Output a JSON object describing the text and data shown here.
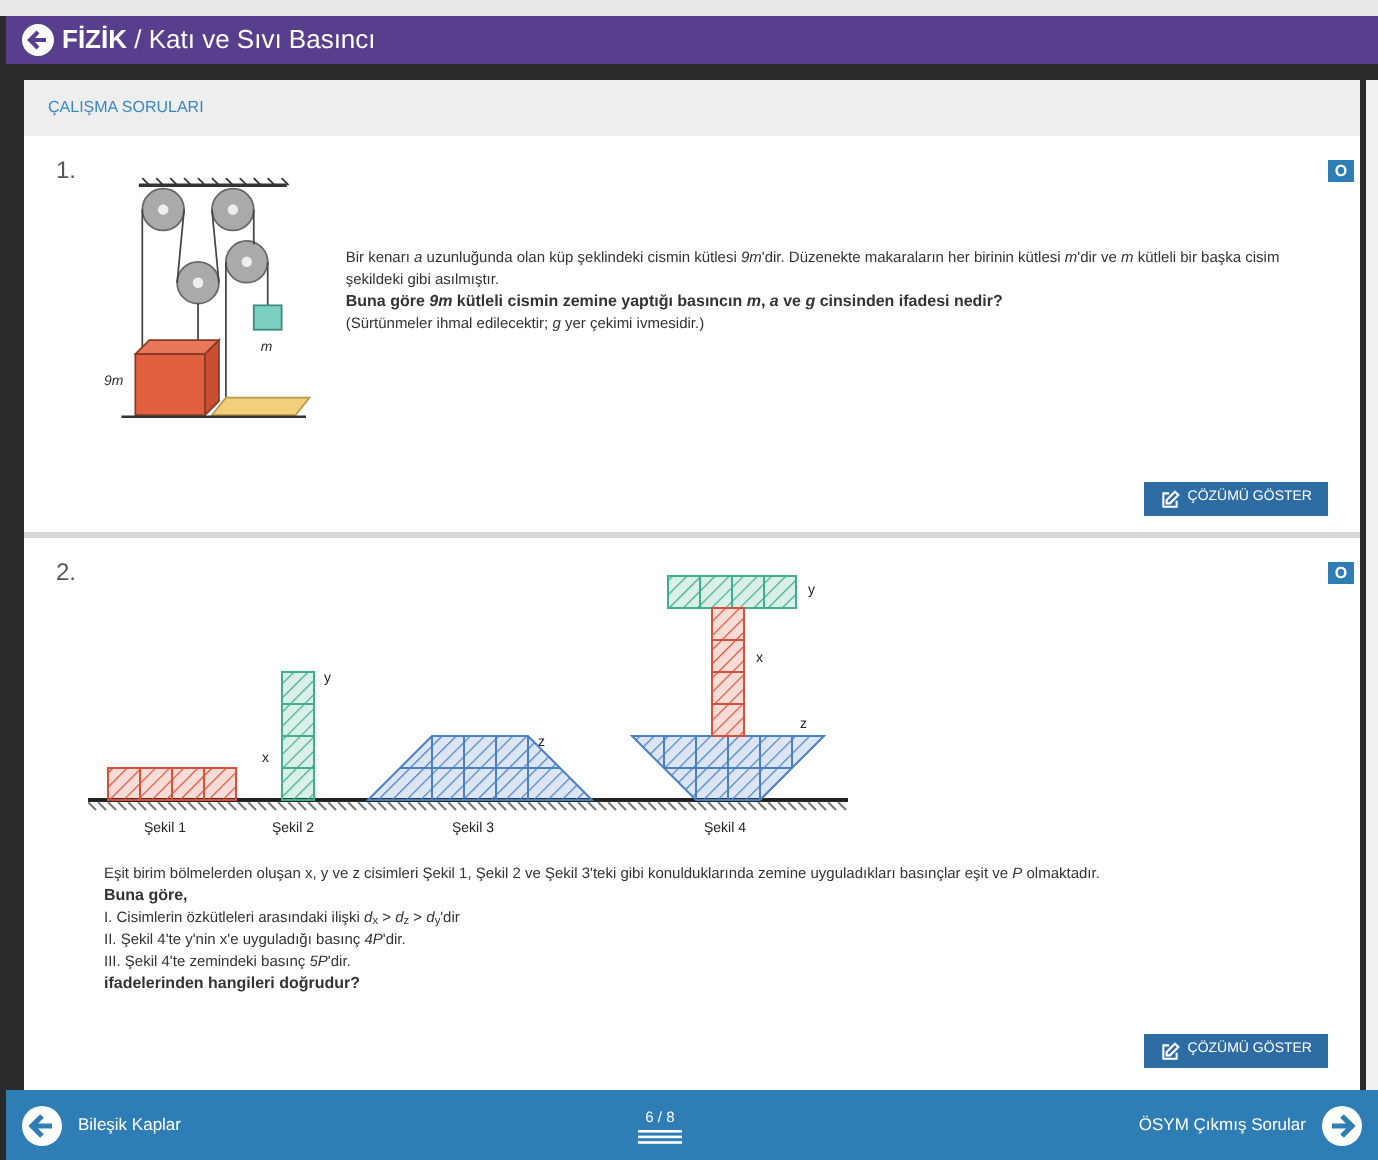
{
  "header": {
    "subject": "FİZİK",
    "topic": " / Katı ve Sıvı Basıncı"
  },
  "section_title": "ÇALIŞMA SORULARI",
  "questions": [
    {
      "number": "1.",
      "kind": "pulley",
      "figure_labels": [
        "9m",
        "m"
      ],
      "paragraphs": [
        {
          "text": "Bir kenarı *a* uzunluğunda olan küp şeklindeki cismin kütlesi *9m*'dir. Düzenekte makaraların her birinin kütlesi *m*'dir ve *m* kütleli bir başka cisim şekildeki gibi asılmıştır.",
          "bold": false
        },
        {
          "text": "Buna göre *9m* kütleli cismin zemine yaptığı basıncın *m*, *a* ve *g* cinsinden ifadesi nedir?",
          "bold": true
        },
        {
          "text": "(Sürtünmeler ihmal edilecektir; *g* yer çekimi ivmesidir.)",
          "bold": false
        }
      ],
      "button": "ÇÖZÜMÜ GÖSTER",
      "marker": "O"
    },
    {
      "number": "2.",
      "kind": "blocks",
      "figure_labels": [
        "x",
        "y",
        "z",
        "y",
        "x",
        "z"
      ],
      "captions": [
        "Şekil 1",
        "Şekil 2",
        "Şekil 3",
        "Şekil 4"
      ],
      "paragraphs": [
        {
          "text": "Eşit birim bölmelerden oluşan x, y ve z cisimleri Şekil 1, Şekil 2 ve Şekil 3'teki gibi konulduklarında zemine uyguladıkları basınçlar eşit ve *P* olmaktadır.",
          "bold": false
        },
        {
          "text": "Buna göre,",
          "bold": true
        },
        {
          "text": "I. Cisimlerin özkütleleri arasındaki ilişki *d*$_{x}$ > *d*$_{z}$ > *d*$_{y}$'dir",
          "bold": false
        },
        {
          "text": "II. Şekil 4'te y'nin x'e uyguladığı basınç *4P*'dir.",
          "bold": false
        },
        {
          "text": "III. Şekil 4'te zemindeki basınç *5P*'dir.",
          "bold": false
        },
        {
          "text": "ifadelerinden hangileri doğrudur?",
          "bold": true
        }
      ],
      "button": "ÇÖZÜMÜ GÖSTER",
      "marker": "O"
    }
  ],
  "footer": {
    "prev": "Bileşik Kaplar",
    "page": "6 / 8",
    "next": "ÖSYM Çıkmış Sorular"
  }
}
